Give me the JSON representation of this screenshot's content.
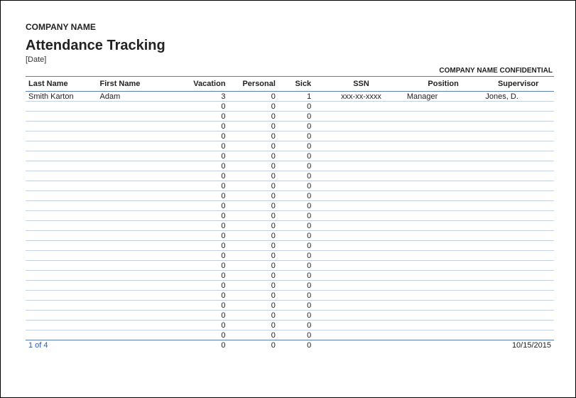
{
  "header": {
    "company": "COMPANY NAME",
    "title": "Attendance Tracking",
    "date_placeholder": "[Date]",
    "confidential": "COMPANY NAME CONFIDENTIAL"
  },
  "columns": {
    "last_name": "Last Name",
    "first_name": "First Name",
    "vacation": "Vacation",
    "personal": "Personal",
    "sick": "Sick",
    "ssn": "SSN",
    "position": "Position",
    "supervisor": "Supervisor"
  },
  "rows": [
    {
      "last_name": "Smith Karton",
      "first_name": "Adam",
      "vacation": "3",
      "personal": "0",
      "sick": "1",
      "ssn": "xxx-xx-xxxx",
      "position": "Manager",
      "supervisor": "Jones, D."
    },
    {
      "last_name": "",
      "first_name": "",
      "vacation": "0",
      "personal": "0",
      "sick": "0",
      "ssn": "",
      "position": "",
      "supervisor": ""
    },
    {
      "last_name": "",
      "first_name": "",
      "vacation": "0",
      "personal": "0",
      "sick": "0",
      "ssn": "",
      "position": "",
      "supervisor": ""
    },
    {
      "last_name": "",
      "first_name": "",
      "vacation": "0",
      "personal": "0",
      "sick": "0",
      "ssn": "",
      "position": "",
      "supervisor": ""
    },
    {
      "last_name": "",
      "first_name": "",
      "vacation": "0",
      "personal": "0",
      "sick": "0",
      "ssn": "",
      "position": "",
      "supervisor": ""
    },
    {
      "last_name": "",
      "first_name": "",
      "vacation": "0",
      "personal": "0",
      "sick": "0",
      "ssn": "",
      "position": "",
      "supervisor": ""
    },
    {
      "last_name": "",
      "first_name": "",
      "vacation": "0",
      "personal": "0",
      "sick": "0",
      "ssn": "",
      "position": "",
      "supervisor": ""
    },
    {
      "last_name": "",
      "first_name": "",
      "vacation": "0",
      "personal": "0",
      "sick": "0",
      "ssn": "",
      "position": "",
      "supervisor": ""
    },
    {
      "last_name": "",
      "first_name": "",
      "vacation": "0",
      "personal": "0",
      "sick": "0",
      "ssn": "",
      "position": "",
      "supervisor": ""
    },
    {
      "last_name": "",
      "first_name": "",
      "vacation": "0",
      "personal": "0",
      "sick": "0",
      "ssn": "",
      "position": "",
      "supervisor": ""
    },
    {
      "last_name": "",
      "first_name": "",
      "vacation": "0",
      "personal": "0",
      "sick": "0",
      "ssn": "",
      "position": "",
      "supervisor": ""
    },
    {
      "last_name": "",
      "first_name": "",
      "vacation": "0",
      "personal": "0",
      "sick": "0",
      "ssn": "",
      "position": "",
      "supervisor": ""
    },
    {
      "last_name": "",
      "first_name": "",
      "vacation": "0",
      "personal": "0",
      "sick": "0",
      "ssn": "",
      "position": "",
      "supervisor": ""
    },
    {
      "last_name": "",
      "first_name": "",
      "vacation": "0",
      "personal": "0",
      "sick": "0",
      "ssn": "",
      "position": "",
      "supervisor": ""
    },
    {
      "last_name": "",
      "first_name": "",
      "vacation": "0",
      "personal": "0",
      "sick": "0",
      "ssn": "",
      "position": "",
      "supervisor": ""
    },
    {
      "last_name": "",
      "first_name": "",
      "vacation": "0",
      "personal": "0",
      "sick": "0",
      "ssn": "",
      "position": "",
      "supervisor": ""
    },
    {
      "last_name": "",
      "first_name": "",
      "vacation": "0",
      "personal": "0",
      "sick": "0",
      "ssn": "",
      "position": "",
      "supervisor": ""
    },
    {
      "last_name": "",
      "first_name": "",
      "vacation": "0",
      "personal": "0",
      "sick": "0",
      "ssn": "",
      "position": "",
      "supervisor": ""
    },
    {
      "last_name": "",
      "first_name": "",
      "vacation": "0",
      "personal": "0",
      "sick": "0",
      "ssn": "",
      "position": "",
      "supervisor": ""
    },
    {
      "last_name": "",
      "first_name": "",
      "vacation": "0",
      "personal": "0",
      "sick": "0",
      "ssn": "",
      "position": "",
      "supervisor": ""
    },
    {
      "last_name": "",
      "first_name": "",
      "vacation": "0",
      "personal": "0",
      "sick": "0",
      "ssn": "",
      "position": "",
      "supervisor": ""
    },
    {
      "last_name": "",
      "first_name": "",
      "vacation": "0",
      "personal": "0",
      "sick": "0",
      "ssn": "",
      "position": "",
      "supervisor": ""
    },
    {
      "last_name": "",
      "first_name": "",
      "vacation": "0",
      "personal": "0",
      "sick": "0",
      "ssn": "",
      "position": "",
      "supervisor": ""
    },
    {
      "last_name": "",
      "first_name": "",
      "vacation": "0",
      "personal": "0",
      "sick": "0",
      "ssn": "",
      "position": "",
      "supervisor": ""
    },
    {
      "last_name": "",
      "first_name": "",
      "vacation": "0",
      "personal": "0",
      "sick": "0",
      "ssn": "",
      "position": "",
      "supervisor": ""
    }
  ],
  "footer": {
    "page_indicator": "1 of 4",
    "date": "10/15/2015"
  }
}
